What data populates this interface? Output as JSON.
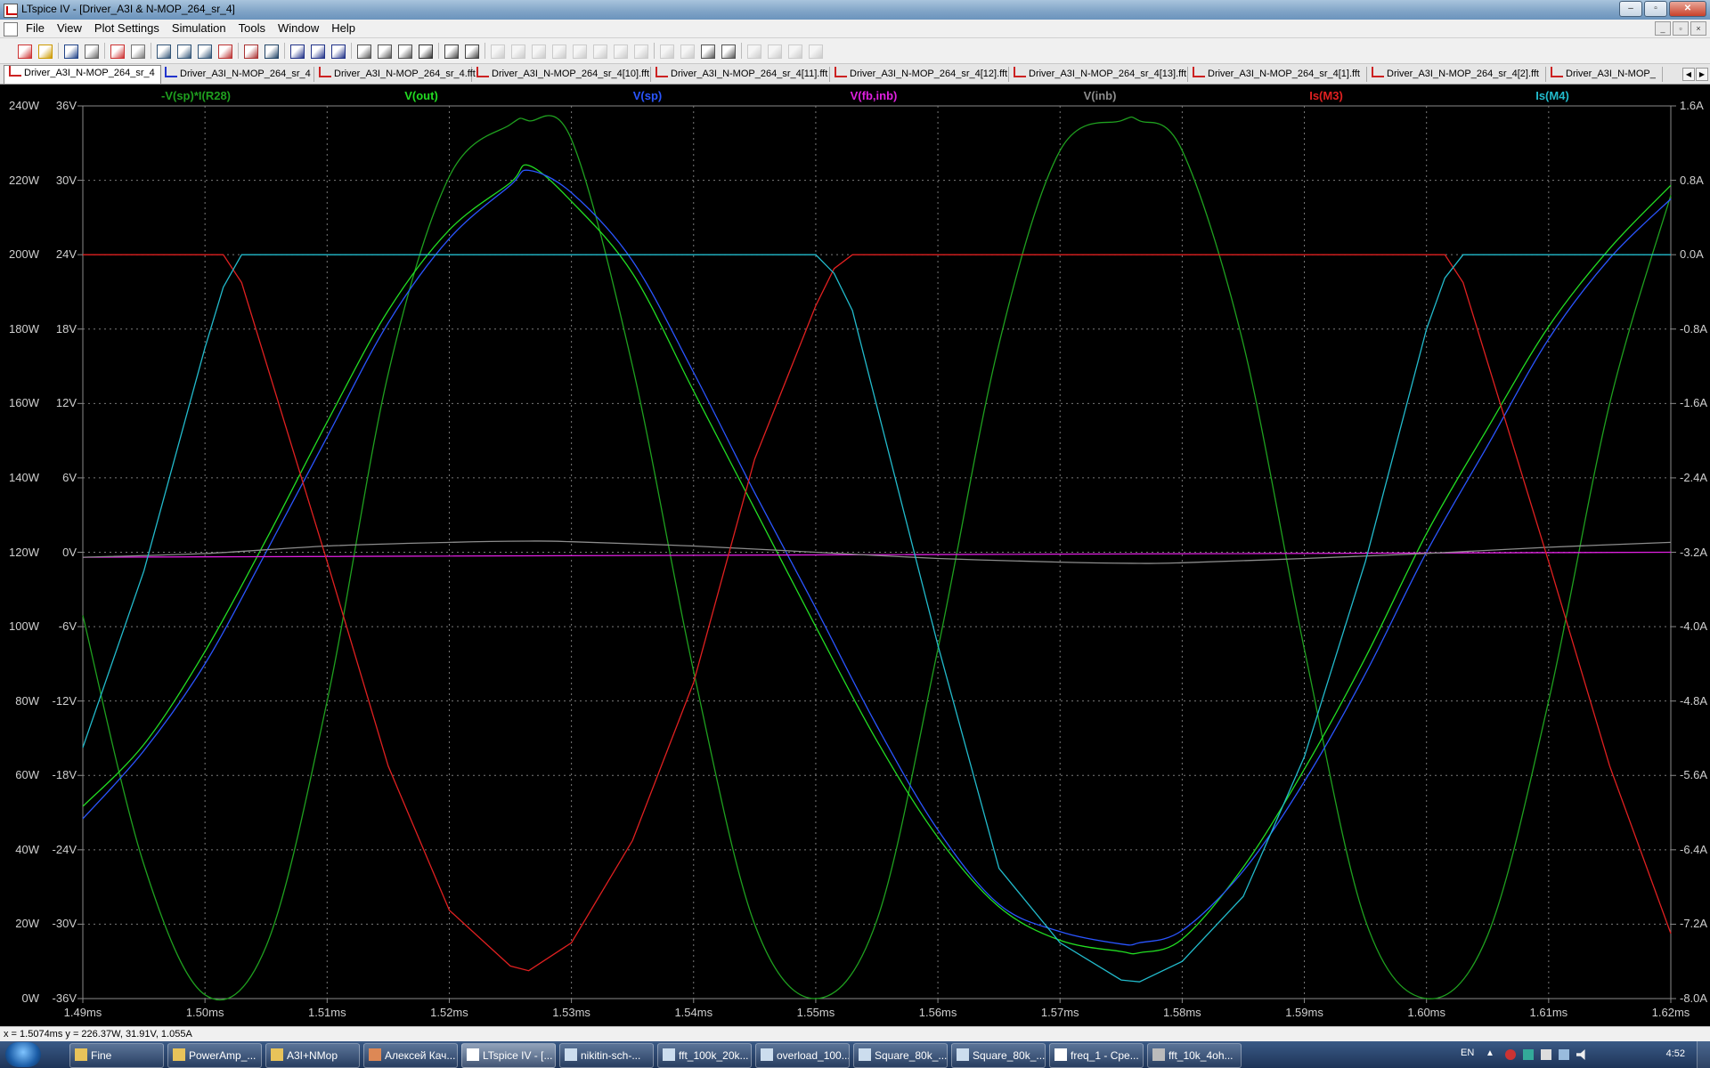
{
  "window": {
    "title": "LTspice IV - [Driver_A3I & N-MOP_264_sr_4]",
    "buttons": [
      "–",
      "▫",
      "✕"
    ]
  },
  "menu": {
    "items": [
      "File",
      "View",
      "Plot Settings",
      "Simulation",
      "Tools",
      "Window",
      "Help"
    ]
  },
  "toolbar": {
    "icons": [
      "new-schematic-icon",
      "open-icon",
      "save-icon",
      "control-panel-icon",
      "run-icon",
      "halt-icon",
      "zoom-in-icon",
      "zoom-box-icon",
      "zoom-out-icon",
      "zoom-cancel-icon",
      "autorange-icon",
      "fft-icon",
      "tile-horizontal-icon",
      "cascade-icon",
      "tile-vertical-icon",
      "cut-icon",
      "copy-icon",
      "paste-icon",
      "find-icon",
      "print-setup-icon",
      "print-icon",
      "wire-icon",
      "ground-icon",
      "label-icon",
      "resistor-icon",
      "capacitor-icon",
      "inductor-icon",
      "diode-icon",
      "component-icon",
      "move-icon",
      "drag-icon",
      "undo-icon",
      "redo-icon",
      "rotate-icon",
      "mirror-icon",
      "text-icon",
      "spice-directive-icon"
    ]
  },
  "tabs": [
    {
      "label": "Driver_A3I_N-MOP_264_sr_4",
      "active": true
    },
    {
      "label": "Driver_A3I_N-MOP_264_sr_4",
      "active": false
    },
    {
      "label": "Driver_A3I_N-MOP_264_sr_4.fft",
      "active": false
    },
    {
      "label": "Driver_A3I_N-MOP_264_sr_4[10].fft",
      "active": false
    },
    {
      "label": "Driver_A3I_N-MOP_264_sr_4[11].fft",
      "active": false
    },
    {
      "label": "Driver_A3I_N-MOP_264_sr_4[12].fft",
      "active": false
    },
    {
      "label": "Driver_A3I_N-MOP_264_sr_4[13].fft",
      "active": false
    },
    {
      "label": "Driver_A3I_N-MOP_264_sr_4[1].fft",
      "active": false
    },
    {
      "label": "Driver_A3I_N-MOP_264_sr_4[2].fft",
      "active": false
    },
    {
      "label": "Driver_A3I_N-MOP_",
      "active": false
    }
  ],
  "chart_data": {
    "type": "line",
    "xlabel_ticks": [
      "1.49ms",
      "1.50ms",
      "1.51ms",
      "1.52ms",
      "1.53ms",
      "1.54ms",
      "1.55ms",
      "1.56ms",
      "1.57ms",
      "1.58ms",
      "1.59ms",
      "1.60ms",
      "1.61ms",
      "1.62ms"
    ],
    "xlim_ms": [
      1.49,
      1.62
    ],
    "left_axis_ticks": [
      "240W",
      "220W",
      "200W",
      "180W",
      "160W",
      "140W",
      "120W",
      "100W",
      "80W",
      "60W",
      "40W",
      "20W",
      "0W"
    ],
    "left_axis2_ticks": [
      "36V",
      "30V",
      "24V",
      "18V",
      "12V",
      "6V",
      "0V",
      "-6V",
      "-12V",
      "-18V",
      "-24V",
      "-30V",
      "-36V"
    ],
    "right_axis_ticks": [
      "1.6A",
      "0.8A",
      "0.0A",
      "-0.8A",
      "-1.6A",
      "-2.4A",
      "-3.2A",
      "-4.0A",
      "-4.8A",
      "-5.6A",
      "-6.4A",
      "-7.2A",
      "-8.0A"
    ],
    "ylim_V": [
      -36,
      36
    ],
    "ylim_A": [
      -8.0,
      1.6
    ],
    "grid": true,
    "background": "#000000",
    "series": [
      {
        "name": "-V(sp)*I(R28)",
        "color": "#1fa01f",
        "unit": "W",
        "x": [
          1.49,
          1.495,
          1.5,
          1.505,
          1.51,
          1.515,
          1.52,
          1.525,
          1.5265,
          1.53,
          1.535,
          1.54,
          1.545,
          1.55,
          1.555,
          1.56,
          1.565,
          1.57,
          1.575,
          1.5765,
          1.58,
          1.585,
          1.59,
          1.595,
          1.6,
          1.605,
          1.61,
          1.615,
          1.62
        ],
        "y": [
          103,
          36,
          1,
          14,
          80,
          168,
          221,
          235,
          236,
          231,
          170,
          88,
          20,
          0,
          21,
          94,
          176,
          228,
          236,
          236,
          228,
          176,
          94,
          21,
          0,
          17,
          80,
          160,
          216
        ]
      },
      {
        "name": "V(out)",
        "color": "#22dd22",
        "unit": "V",
        "x": [
          1.49,
          1.495,
          1.5,
          1.505,
          1.51,
          1.515,
          1.52,
          1.525,
          1.5265,
          1.53,
          1.535,
          1.54,
          1.545,
          1.55,
          1.555,
          1.56,
          1.565,
          1.57,
          1.575,
          1.5765,
          1.58,
          1.585,
          1.59,
          1.595,
          1.6,
          1.605,
          1.61,
          1.615,
          1.62
        ],
        "y": [
          -20.5,
          -15.5,
          -8,
          1,
          10.5,
          19.5,
          26,
          29.8,
          31.2,
          28.3,
          22.5,
          13,
          3.5,
          -6,
          -15.2,
          -23,
          -28.6,
          -31.3,
          -32.2,
          -32.3,
          -31.2,
          -25.4,
          -17.5,
          -8.5,
          1.5,
          10,
          18.2,
          24.5,
          29.6
        ]
      },
      {
        "name": "V(sp)",
        "color": "#2a55ff",
        "unit": "V",
        "x": [
          1.49,
          1.495,
          1.5,
          1.505,
          1.51,
          1.515,
          1.52,
          1.525,
          1.5265,
          1.53,
          1.535,
          1.54,
          1.545,
          1.55,
          1.555,
          1.56,
          1.565,
          1.57,
          1.575,
          1.5765,
          1.58,
          1.585,
          1.59,
          1.595,
          1.6,
          1.605,
          1.61,
          1.615,
          1.62
        ],
        "y": [
          -21.5,
          -16,
          -9,
          0,
          9.3,
          18.5,
          25.3,
          29.6,
          30.8,
          29,
          23.5,
          14.5,
          4.8,
          -4.5,
          -14,
          -22.4,
          -28.4,
          -30.6,
          -31.6,
          -31.5,
          -30.5,
          -25.7,
          -18.5,
          -9.8,
          0,
          8.6,
          17.2,
          23.7,
          28.5
        ]
      },
      {
        "name": "V(fb,inb)",
        "color": "#e020e0",
        "unit": "V",
        "x": [
          1.49,
          1.62
        ],
        "y": [
          -0.4,
          0
        ]
      },
      {
        "name": "V(inb)",
        "color": "#8c8c8c",
        "unit": "V",
        "x": [
          1.49,
          1.5,
          1.51,
          1.52,
          1.5265,
          1.53,
          1.54,
          1.55,
          1.56,
          1.57,
          1.5765,
          1.58,
          1.59,
          1.6,
          1.61,
          1.62
        ],
        "y": [
          -0.4,
          -0.1,
          0.5,
          0.8,
          0.9,
          0.85,
          0.5,
          0,
          -0.5,
          -0.8,
          -0.9,
          -0.85,
          -0.5,
          -0.1,
          0.4,
          0.8
        ]
      },
      {
        "name": "Is(M3)",
        "color": "#e02020",
        "unit": "A",
        "x": [
          1.49,
          1.5015,
          1.503,
          1.51,
          1.515,
          1.52,
          1.525,
          1.5265,
          1.53,
          1.535,
          1.54,
          1.545,
          1.55,
          1.5515,
          1.553,
          1.56,
          1.6,
          1.6015,
          1.603,
          1.61,
          1.615,
          1.62
        ],
        "y": [
          0,
          0,
          -0.3,
          -3.3,
          -5.5,
          -7.05,
          -7.65,
          -7.7,
          -7.4,
          -6.3,
          -4.6,
          -2.2,
          -0.55,
          -0.15,
          0,
          0,
          0,
          0,
          -0.3,
          -3.3,
          -5.5,
          -7.3
        ]
      },
      {
        "name": "Is(M4)",
        "color": "#22bbcc",
        "unit": "A",
        "x": [
          1.49,
          1.495,
          1.5,
          1.5015,
          1.503,
          1.55,
          1.5515,
          1.553,
          1.56,
          1.565,
          1.57,
          1.575,
          1.5765,
          1.58,
          1.585,
          1.59,
          1.595,
          1.6,
          1.6015,
          1.603,
          1.62
        ],
        "y": [
          -5.3,
          -3.4,
          -1.0,
          -0.35,
          0,
          0,
          -0.2,
          -0.6,
          -4.2,
          -6.6,
          -7.4,
          -7.8,
          -7.82,
          -7.6,
          -6.9,
          -5.4,
          -3.3,
          -0.8,
          -0.25,
          0,
          0
        ]
      }
    ]
  },
  "status": {
    "text": "x = 1.5074ms    y = 226.37W, 31.91V, 1.055A"
  },
  "taskbar": {
    "buttons": [
      {
        "label": "Fine",
        "active": false
      },
      {
        "label": "PowerAmp_...",
        "active": false
      },
      {
        "label": "A3I+NMop",
        "active": false
      },
      {
        "label": "Алексей Кач...",
        "active": false
      },
      {
        "label": "LTspice IV - [...",
        "active": true
      },
      {
        "label": "nikitin-sch-...",
        "active": false
      },
      {
        "label": "fft_100k_20k...",
        "active": false
      },
      {
        "label": "overload_100...",
        "active": false
      },
      {
        "label": "Square_80k_...",
        "active": false
      },
      {
        "label": "Square_80k_...",
        "active": false
      },
      {
        "label": "freq_1 - Сре...",
        "active": false
      },
      {
        "label": "fft_10k_4oh...",
        "active": false
      }
    ],
    "lang": "EN",
    "clock": "4:52"
  }
}
